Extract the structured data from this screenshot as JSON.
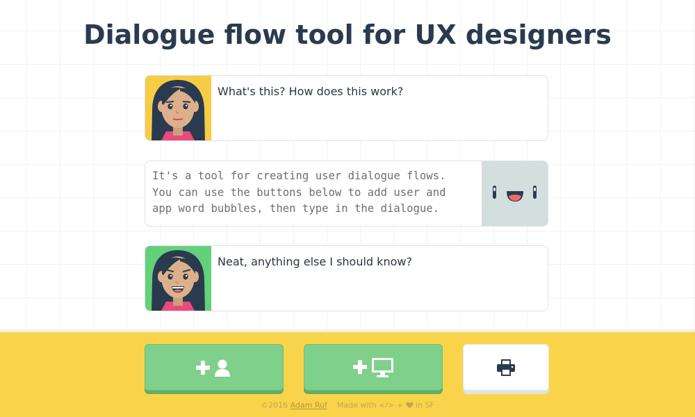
{
  "header": {
    "title": "Dialogue flow tool for UX designers"
  },
  "bubbles": [
    {
      "speaker": "user",
      "text": "What's this? How does this work?",
      "avatar_bg": "#f7cc45",
      "avatar_icon": "woman-avatar-icon"
    },
    {
      "speaker": "app",
      "text": "It's a tool for creating user dialogue flows.\nYou can use the buttons below to add user and\napp word bubbles, then type in the dialogue.",
      "avatar_bg": "#d3dfdf",
      "avatar_icon": "robot-face-icon"
    },
    {
      "speaker": "user",
      "text": "Neat, anything else I should know?",
      "avatar_bg": "#63d17a",
      "avatar_icon": "woman-avatar-icon"
    }
  ],
  "toolbar": {
    "buttons": [
      {
        "icon": "add-user-icon",
        "action": "add user bubble"
      },
      {
        "icon": "add-app-icon",
        "action": "add app bubble"
      },
      {
        "icon": "print-icon",
        "action": "print"
      }
    ]
  },
  "footer": {
    "copyright": "©2016",
    "author": "Adam Ruf",
    "made_with": "Made with",
    "code_glyph": "</>",
    "plus": "+",
    "location": "in SF"
  },
  "colors": {
    "title": "#2a3a4f",
    "footer_bg": "#f9d44b",
    "button_green": "#7fd08a",
    "button_white": "#ffffff"
  }
}
